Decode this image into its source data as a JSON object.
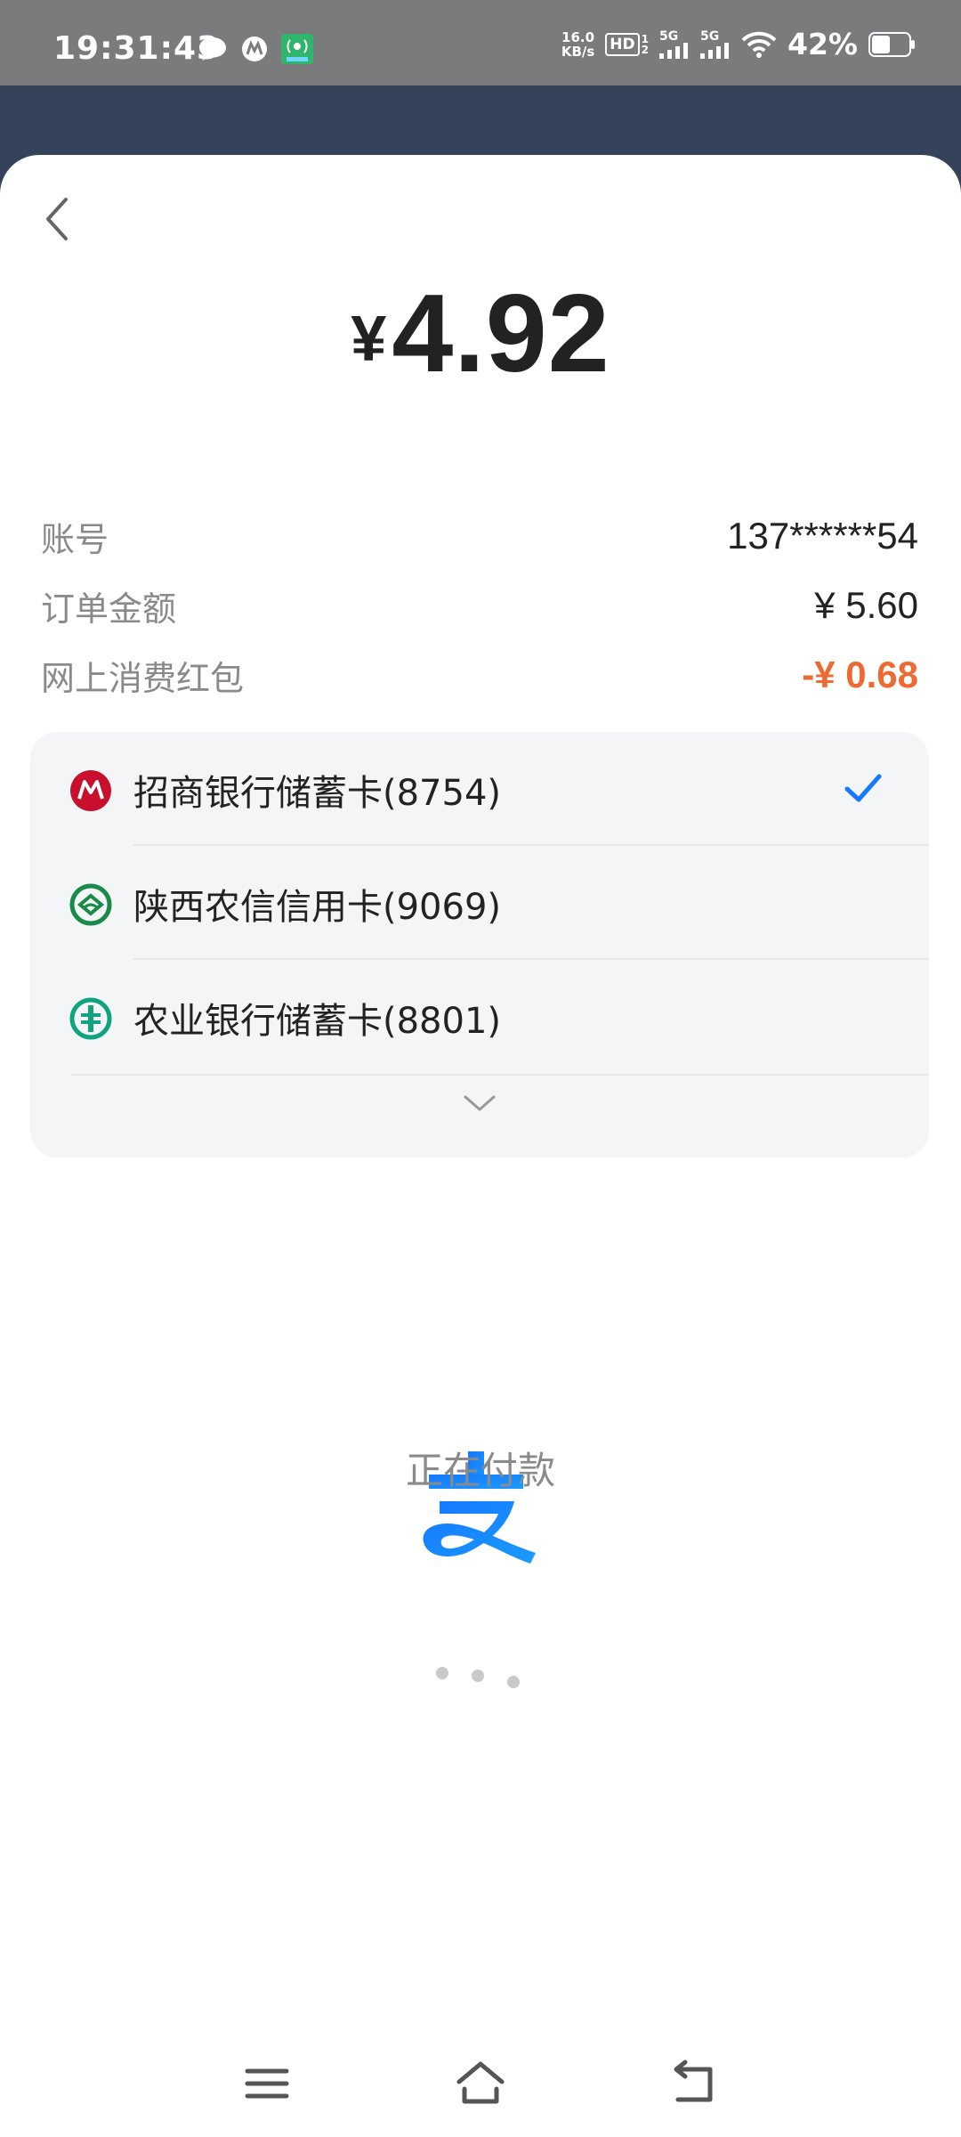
{
  "status_bar": {
    "time": "19:31:43",
    "speed_value": "16.0",
    "speed_unit": "KB/s",
    "hd_label": "HD",
    "signal1_label": "5G",
    "signal2_label": "5G",
    "battery_percent": "42%"
  },
  "payment": {
    "currency_symbol": "¥",
    "amount": "4.92",
    "rows": [
      {
        "label": "账号",
        "value": "137******54"
      },
      {
        "label": "订单金额",
        "value": "¥ 5.60"
      },
      {
        "label": "网上消费红包",
        "value": "-¥ 0.68"
      }
    ],
    "cards": [
      {
        "name": "招商银行储蓄卡(8754)",
        "selected": true,
        "icon": "cmb-bank-icon"
      },
      {
        "name": "陕西农信信用卡(9069)",
        "selected": false,
        "icon": "shaanxi-rcc-icon"
      },
      {
        "name": "农业银行储蓄卡(8801)",
        "selected": false,
        "icon": "abc-bank-icon"
      }
    ]
  },
  "loading": {
    "text": "正在付款"
  },
  "colors": {
    "accent_blue": "#1677ff",
    "discount_red": "#ee6a33",
    "header_bg": "#34425a"
  }
}
